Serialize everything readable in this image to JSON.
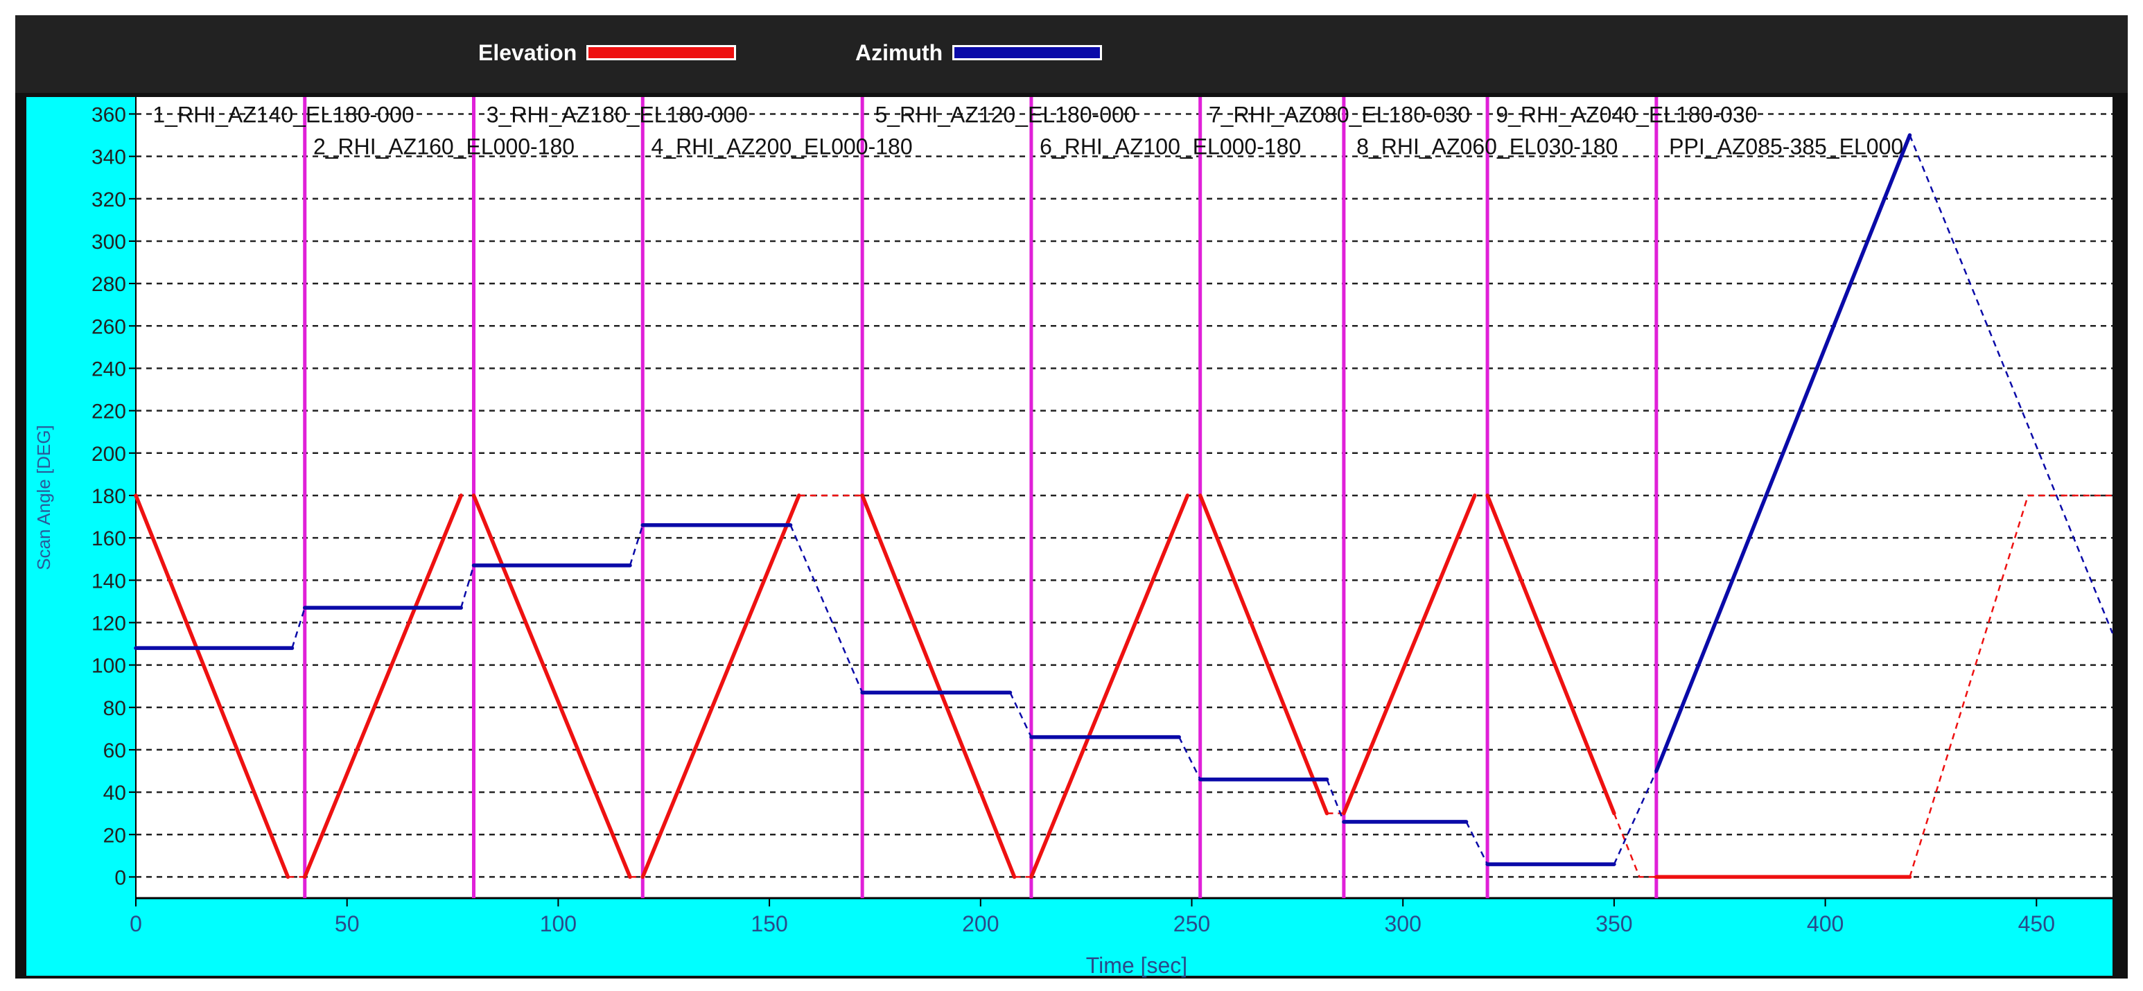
{
  "legend": [
    {
      "label": "Elevation",
      "color": "#ee1111"
    },
    {
      "label": "Azimuth",
      "color": "#0a0aa8"
    }
  ],
  "chart_data": {
    "type": "line",
    "xlabel": "Time [sec]",
    "ylabel": "Scan Angle [DEG]",
    "xlim": [
      0,
      468
    ],
    "ylim": [
      -10,
      368
    ],
    "x_ticks": [
      0,
      50,
      100,
      150,
      200,
      250,
      300,
      350,
      400,
      450
    ],
    "y_ticks": [
      0,
      20,
      40,
      60,
      80,
      100,
      120,
      140,
      160,
      180,
      200,
      220,
      240,
      260,
      280,
      300,
      320,
      340,
      360
    ],
    "grid": "horizontal dashed",
    "legend_position": "top",
    "scan_boundaries": [
      0,
      40,
      80,
      120,
      172,
      212,
      252,
      286,
      320,
      360
    ],
    "scan_labels": [
      {
        "text": "1_RHI_AZ140_EL180-000",
        "x": 4,
        "y": 356
      },
      {
        "text": "2_RHI_AZ160_EL000-180",
        "x": 42,
        "y": 341
      },
      {
        "text": "3_RHI_AZ180_EL180-000",
        "x": 83,
        "y": 356
      },
      {
        "text": "4_RHI_AZ200_EL000-180",
        "x": 122,
        "y": 341
      },
      {
        "text": "5_RHI_AZ120_EL180-000",
        "x": 175,
        "y": 356
      },
      {
        "text": "6_RHI_AZ100_EL000-180",
        "x": 214,
        "y": 341
      },
      {
        "text": "7_RHI_AZ080_EL180-030",
        "x": 254,
        "y": 356
      },
      {
        "text": "8_RHI_AZ060_EL030-180",
        "x": 289,
        "y": 341
      },
      {
        "text": "9_RHI_AZ040_EL180-030",
        "x": 322,
        "y": 356
      },
      {
        "text": "PPI_AZ085-385_EL000",
        "x": 363,
        "y": 341
      }
    ],
    "series": [
      {
        "name": "Elevation",
        "color": "#ee1111",
        "solid_segments": [
          [
            [
              0,
              180
            ],
            [
              36,
              0
            ]
          ],
          [
            [
              40,
              0
            ],
            [
              77,
              180
            ]
          ],
          [
            [
              80,
              180
            ],
            [
              117,
              0
            ]
          ],
          [
            [
              120,
              0
            ],
            [
              157,
              180
            ]
          ],
          [
            [
              172,
              180
            ],
            [
              208,
              0
            ]
          ],
          [
            [
              212,
              0
            ],
            [
              249,
              180
            ]
          ],
          [
            [
              252,
              180
            ],
            [
              282,
              30
            ]
          ],
          [
            [
              286,
              30
            ],
            [
              317,
              180
            ]
          ],
          [
            [
              320,
              180
            ],
            [
              350,
              30
            ]
          ],
          [
            [
              360,
              0
            ],
            [
              420,
              0
            ]
          ]
        ],
        "dashed_segments": [
          [
            [
              36,
              0
            ],
            [
              40,
              0
            ]
          ],
          [
            [
              117,
              0
            ],
            [
              120,
              0
            ]
          ],
          [
            [
              157,
              180
            ],
            [
              172,
              180
            ]
          ],
          [
            [
              208,
              0
            ],
            [
              212,
              0
            ]
          ],
          [
            [
              282,
              30
            ],
            [
              286,
              30
            ]
          ],
          [
            [
              350,
              30
            ],
            [
              356,
              0
            ],
            [
              360,
              0
            ]
          ],
          [
            [
              420,
              0
            ],
            [
              448,
              180
            ],
            [
              468,
              180
            ]
          ]
        ]
      },
      {
        "name": "Azimuth",
        "color": "#0a0aa8",
        "solid_segments": [
          [
            [
              0,
              108
            ],
            [
              37,
              108
            ]
          ],
          [
            [
              40,
              127
            ],
            [
              77,
              127
            ]
          ],
          [
            [
              80,
              147
            ],
            [
              117,
              147
            ]
          ],
          [
            [
              120,
              166
            ],
            [
              155,
              166
            ]
          ],
          [
            [
              172,
              87
            ],
            [
              207,
              87
            ]
          ],
          [
            [
              212,
              66
            ],
            [
              247,
              66
            ]
          ],
          [
            [
              252,
              46
            ],
            [
              282,
              46
            ]
          ],
          [
            [
              286,
              26
            ],
            [
              315,
              26
            ]
          ],
          [
            [
              320,
              6
            ],
            [
              350,
              6
            ]
          ],
          [
            [
              360,
              50
            ],
            [
              420,
              350
            ]
          ]
        ],
        "dashed_segments": [
          [
            [
              37,
              108
            ],
            [
              40,
              127
            ]
          ],
          [
            [
              77,
              127
            ],
            [
              80,
              147
            ]
          ],
          [
            [
              117,
              147
            ],
            [
              120,
              166
            ]
          ],
          [
            [
              155,
              166
            ],
            [
              172,
              87
            ]
          ],
          [
            [
              207,
              87
            ],
            [
              212,
              66
            ]
          ],
          [
            [
              247,
              66
            ],
            [
              252,
              46
            ]
          ],
          [
            [
              282,
              46
            ],
            [
              286,
              26
            ]
          ],
          [
            [
              315,
              26
            ],
            [
              320,
              6
            ]
          ],
          [
            [
              350,
              6
            ],
            [
              360,
              50
            ]
          ],
          [
            [
              420,
              350
            ],
            [
              468,
              115
            ]
          ]
        ]
      }
    ]
  }
}
